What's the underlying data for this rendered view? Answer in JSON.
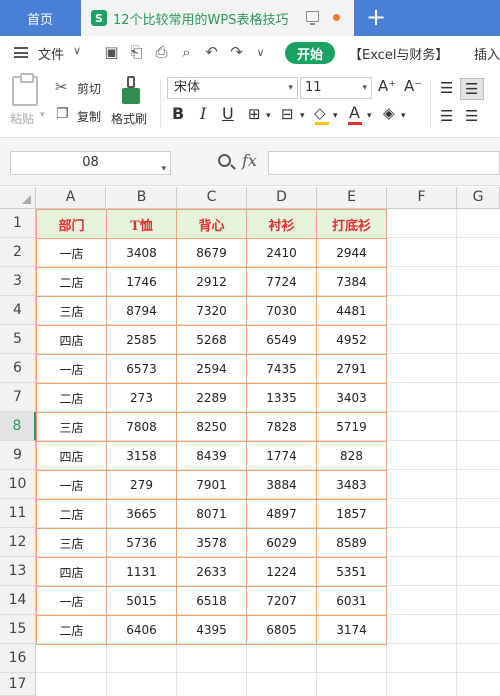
{
  "tabs": {
    "home": "首页",
    "doc_title": "12个比较常用的WPS表格技巧",
    "logo_letter": "S"
  },
  "menu": {
    "file": "文件",
    "start": "开始",
    "excel_finance": "【Excel与财务】",
    "insert": "插入"
  },
  "ribbon": {
    "paste": "粘贴",
    "cut": "剪切",
    "copy": "复制",
    "format_painter": "格式刷",
    "font_name": "宋体",
    "font_size": "11",
    "bold": "B",
    "italic": "I",
    "underline": "U",
    "grow_font": "A⁺",
    "shrink_font": "A⁻",
    "font_color_letter": "A"
  },
  "formula_bar": {
    "cell_ref": "08",
    "fx": "fx",
    "formula": ""
  },
  "grid": {
    "columns": [
      "A",
      "B",
      "C",
      "D",
      "E",
      "F",
      "G"
    ],
    "rows": [
      "1",
      "2",
      "3",
      "4",
      "5",
      "6",
      "7",
      "8",
      "9",
      "10",
      "11",
      "12",
      "13",
      "14",
      "15",
      "16",
      "17"
    ],
    "active_row": "8",
    "table_header": [
      "部门",
      "T恤",
      "背心",
      "衬衫",
      "打底衫"
    ],
    "table_rows": [
      [
        "一店",
        "3408",
        "8679",
        "2410",
        "2944"
      ],
      [
        "二店",
        "1746",
        "2912",
        "7724",
        "7384"
      ],
      [
        "三店",
        "8794",
        "7320",
        "7030",
        "4481"
      ],
      [
        "四店",
        "2585",
        "5268",
        "6549",
        "4952"
      ],
      [
        "一店",
        "6573",
        "2594",
        "7435",
        "2791"
      ],
      [
        "二店",
        "273",
        "2289",
        "1335",
        "3403"
      ],
      [
        "三店",
        "7808",
        "8250",
        "7828",
        "5719"
      ],
      [
        "四店",
        "3158",
        "8439",
        "1774",
        "828"
      ],
      [
        "一店",
        "279",
        "7901",
        "3884",
        "3483"
      ],
      [
        "二店",
        "3665",
        "8071",
        "4897",
        "1857"
      ],
      [
        "三店",
        "5736",
        "3578",
        "6029",
        "8589"
      ],
      [
        "四店",
        "1131",
        "2633",
        "1224",
        "5351"
      ],
      [
        "一店",
        "5015",
        "6518",
        "7207",
        "6031"
      ],
      [
        "二店",
        "6406",
        "4395",
        "6805",
        "3174"
      ]
    ]
  },
  "colors": {
    "accent_green": "#1aa260",
    "tab_blue": "#4a7fd6",
    "table_border": "#f4a46a",
    "header_fill": "#e5f3dc",
    "header_text": "#e03030"
  }
}
